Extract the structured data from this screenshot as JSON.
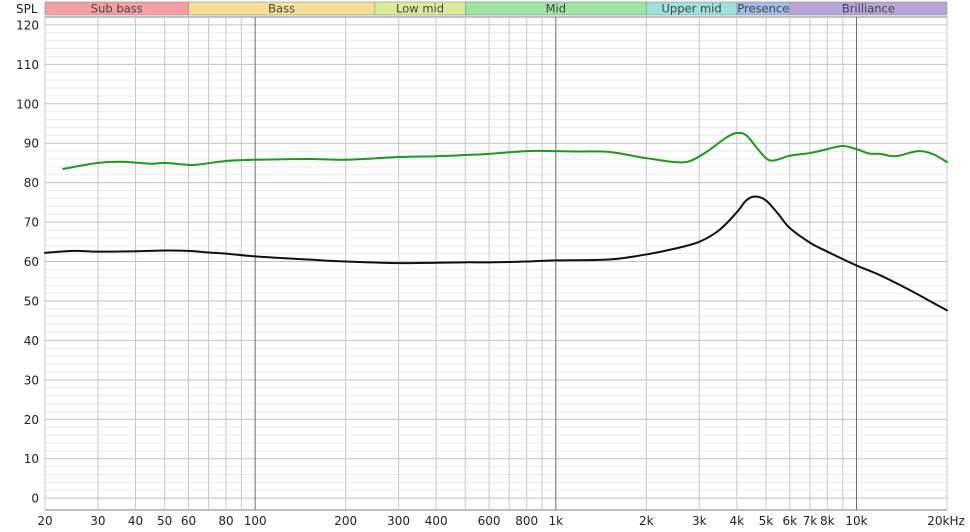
{
  "chart_data": {
    "type": "line",
    "ylabel": "SPL",
    "xlabel": "",
    "x_scale": "log",
    "xlim": [
      20,
      20000
    ],
    "ylim": [
      -3,
      122
    ],
    "grid": true,
    "y_ticks": [
      0,
      10,
      20,
      30,
      40,
      50,
      60,
      70,
      80,
      90,
      100,
      110,
      120
    ],
    "x_ticks": [
      {
        "v": 20,
        "label": "20"
      },
      {
        "v": 30,
        "label": "30"
      },
      {
        "v": 40,
        "label": "40"
      },
      {
        "v": 50,
        "label": "50"
      },
      {
        "v": 60,
        "label": "60"
      },
      {
        "v": 80,
        "label": "80"
      },
      {
        "v": 100,
        "label": "100"
      },
      {
        "v": 200,
        "label": "200"
      },
      {
        "v": 300,
        "label": "300"
      },
      {
        "v": 400,
        "label": "400"
      },
      {
        "v": 600,
        "label": "600"
      },
      {
        "v": 800,
        "label": "800"
      },
      {
        "v": 1000,
        "label": "1k"
      },
      {
        "v": 2000,
        "label": "2k"
      },
      {
        "v": 3000,
        "label": "3k"
      },
      {
        "v": 4000,
        "label": "4k"
      },
      {
        "v": 5000,
        "label": "5k"
      },
      {
        "v": 6000,
        "label": "6k"
      },
      {
        "v": 7000,
        "label": "7k"
      },
      {
        "v": 8000,
        "label": "8k"
      },
      {
        "v": 10000,
        "label": "10k"
      },
      {
        "v": 20000,
        "label": "20kHz"
      }
    ],
    "bands": [
      {
        "label": "Sub bass",
        "from": 20,
        "to": 60,
        "color": "#f4a0a0"
      },
      {
        "label": "Bass",
        "from": 60,
        "to": 250,
        "color": "#f8df98"
      },
      {
        "label": "Low mid",
        "from": 250,
        "to": 500,
        "color": "#d8ec9c"
      },
      {
        "label": "Mid",
        "from": 500,
        "to": 2000,
        "color": "#9ee4a4"
      },
      {
        "label": "Upper mid",
        "from": 2000,
        "to": 4000,
        "color": "#9ee0dc"
      },
      {
        "label": "Presence",
        "from": 4000,
        "to": 6000,
        "color": "#a2bce8"
      },
      {
        "label": "Brilliance",
        "from": 6000,
        "to": 20000,
        "color": "#b8a4d8"
      }
    ],
    "series": [
      {
        "color": "#1a9a1a",
        "points": [
          [
            23,
            83.5
          ],
          [
            30,
            85
          ],
          [
            36,
            85.3
          ],
          [
            45,
            84.8
          ],
          [
            50,
            85
          ],
          [
            60,
            84.5
          ],
          [
            65,
            84.6
          ],
          [
            80,
            85.5
          ],
          [
            100,
            85.8
          ],
          [
            150,
            86
          ],
          [
            200,
            85.8
          ],
          [
            300,
            86.5
          ],
          [
            400,
            86.7
          ],
          [
            500,
            87
          ],
          [
            600,
            87.3
          ],
          [
            800,
            88
          ],
          [
            1000,
            88
          ],
          [
            1200,
            87.9
          ],
          [
            1500,
            87.8
          ],
          [
            2000,
            86.2
          ],
          [
            2500,
            85.2
          ],
          [
            2800,
            85.5
          ],
          [
            3200,
            88
          ],
          [
            3700,
            91.5
          ],
          [
            4000,
            92.6
          ],
          [
            4300,
            92
          ],
          [
            4700,
            88.5
          ],
          [
            5000,
            86.2
          ],
          [
            5300,
            85.6
          ],
          [
            6000,
            86.8
          ],
          [
            7000,
            87.5
          ],
          [
            8000,
            88.5
          ],
          [
            9000,
            89.3
          ],
          [
            10000,
            88.5
          ],
          [
            11000,
            87.4
          ],
          [
            12000,
            87.3
          ],
          [
            13500,
            86.7
          ],
          [
            16000,
            88
          ],
          [
            18000,
            87.2
          ],
          [
            20000,
            85.2
          ]
        ]
      },
      {
        "color": "#111111",
        "points": [
          [
            20,
            62.2
          ],
          [
            25,
            62.7
          ],
          [
            30,
            62.5
          ],
          [
            40,
            62.6
          ],
          [
            50,
            62.8
          ],
          [
            60,
            62.7
          ],
          [
            70,
            62.3
          ],
          [
            80,
            62
          ],
          [
            100,
            61.3
          ],
          [
            150,
            60.5
          ],
          [
            200,
            60
          ],
          [
            300,
            59.6
          ],
          [
            400,
            59.7
          ],
          [
            500,
            59.8
          ],
          [
            600,
            59.8
          ],
          [
            800,
            60
          ],
          [
            1000,
            60.3
          ],
          [
            1500,
            60.5
          ],
          [
            2000,
            61.8
          ],
          [
            2500,
            63.3
          ],
          [
            3000,
            65
          ],
          [
            3500,
            68
          ],
          [
            4000,
            72.5
          ],
          [
            4300,
            75.5
          ],
          [
            4600,
            76.5
          ],
          [
            5000,
            75.5
          ],
          [
            5500,
            72
          ],
          [
            6000,
            68.5
          ],
          [
            7000,
            64.8
          ],
          [
            8000,
            62.5
          ],
          [
            10000,
            59
          ],
          [
            12000,
            56.5
          ],
          [
            15000,
            52.8
          ],
          [
            18000,
            49.5
          ],
          [
            20000,
            47.6
          ]
        ]
      }
    ]
  }
}
